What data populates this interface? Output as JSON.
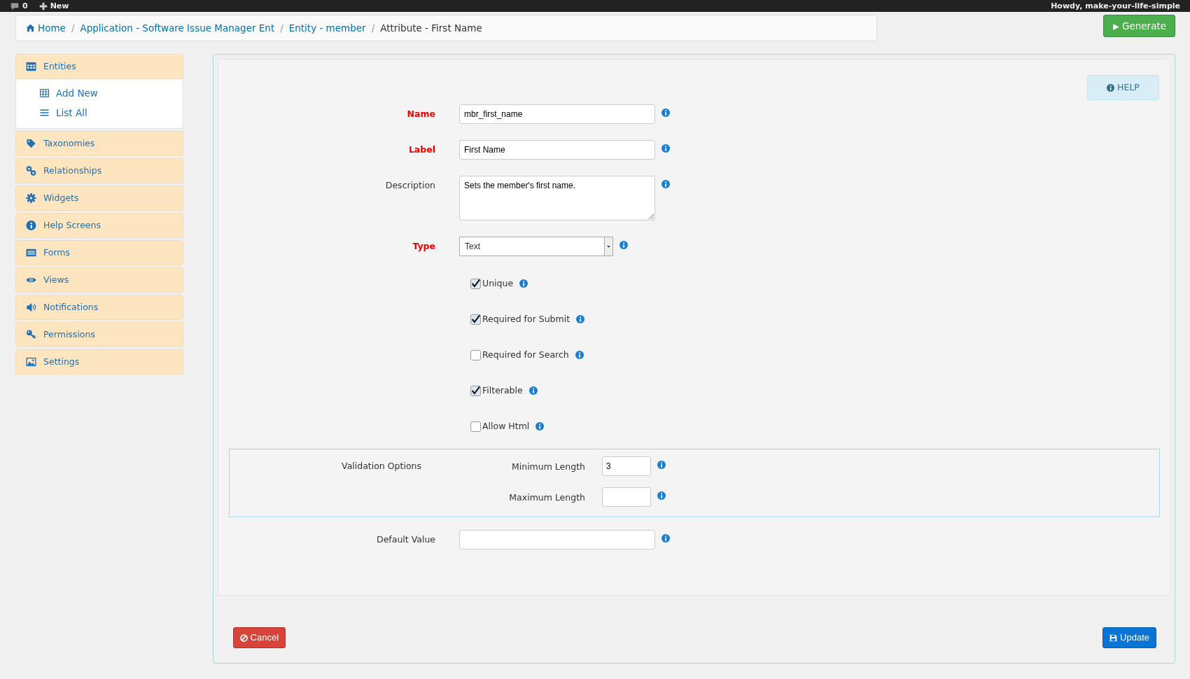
{
  "admin_bar": {
    "comments_count": "0",
    "new_label": "New",
    "greeting": "Howdy, make-your-life-simple"
  },
  "breadcrumb": [
    {
      "label": "Home",
      "current": false
    },
    {
      "separator": "/",
      "label": "Application - Software Issue Manager Ent",
      "current": false
    },
    {
      "separator": "/",
      "label": "Entity - member",
      "current": false
    },
    {
      "separator": "/",
      "label": "Attribute - First Name",
      "current": true
    }
  ],
  "generate_button": "Generate",
  "sidebar": {
    "items": [
      {
        "label": "Entities",
        "expanded": true,
        "children": [
          {
            "label": "Add New"
          },
          {
            "label": "List All"
          }
        ]
      },
      {
        "label": "Taxonomies",
        "expanded": false
      },
      {
        "label": "Relationships",
        "expanded": false
      },
      {
        "label": "Widgets",
        "expanded": false
      },
      {
        "label": "Help Screens",
        "expanded": false
      },
      {
        "label": "Forms",
        "expanded": false
      },
      {
        "label": "Views",
        "expanded": false
      },
      {
        "label": "Notifications",
        "expanded": false
      },
      {
        "label": "Permissions",
        "expanded": false
      },
      {
        "label": "Settings",
        "expanded": false
      }
    ]
  },
  "help_button": "HELP",
  "fields": [
    {
      "kind": "text",
      "label": "Name",
      "required": true,
      "value": "mbr_first_name"
    },
    {
      "kind": "text",
      "label": "Label",
      "required": true,
      "value": "First Name"
    },
    {
      "kind": "textarea",
      "label": "Description",
      "required": false,
      "value": "Sets the member's first name."
    },
    {
      "kind": "select",
      "label": "Type",
      "required": true,
      "value": "Text"
    },
    {
      "kind": "checkbox",
      "label": "Unique",
      "checked": true
    },
    {
      "kind": "checkbox",
      "label": "Required for Submit",
      "checked": true
    },
    {
      "kind": "checkbox",
      "label": "Required for Search",
      "checked": false
    },
    {
      "kind": "checkbox",
      "label": "Filterable",
      "checked": true
    },
    {
      "kind": "checkbox",
      "label": "Allow Html",
      "checked": false
    }
  ],
  "validation": {
    "title": "Validation Options",
    "fields": [
      {
        "label": "Minimum Length",
        "value": "3"
      },
      {
        "label": "Maximum Length"
      }
    ]
  },
  "default_value": {
    "label": "Default Value"
  },
  "cancel_button": "Cancel",
  "update_button": "Update"
}
